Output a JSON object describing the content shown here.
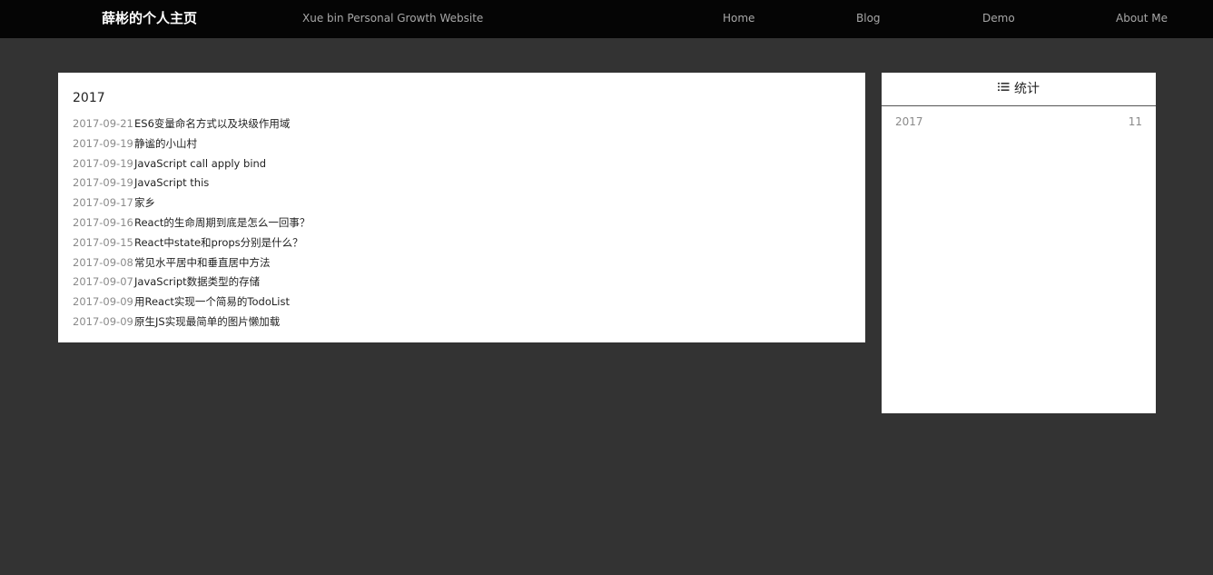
{
  "navbar": {
    "brand": "薛彬的个人主页",
    "tagline": "Xue bin Personal Growth Website",
    "links": [
      {
        "label": "Home"
      },
      {
        "label": "Blog"
      },
      {
        "label": "Demo"
      },
      {
        "label": "About Me"
      }
    ]
  },
  "archive": {
    "year": "2017",
    "posts": [
      {
        "date": "2017-09-21",
        "title": "ES6变量命名方式以及块级作用域"
      },
      {
        "date": "2017-09-19",
        "title": "静谧的小山村"
      },
      {
        "date": "2017-09-19",
        "title": "JavaScript call apply bind"
      },
      {
        "date": "2017-09-19",
        "title": "JavaScript this"
      },
      {
        "date": "2017-09-17",
        "title": "家乡"
      },
      {
        "date": "2017-09-16",
        "title": "React的生命周期到底是怎么一回事？"
      },
      {
        "date": "2017-09-15",
        "title": "React中state和props分别是什么？"
      },
      {
        "date": "2017-09-08",
        "title": "常见水平居中和垂直居中方法"
      },
      {
        "date": "2017-09-07",
        "title": "JavaScript数据类型的存储"
      },
      {
        "date": "2017-09-09",
        "title": "用React实现一个简易的TodoList"
      },
      {
        "date": "2017-09-09",
        "title": "原生JS实现最简单的图片懒加载"
      }
    ]
  },
  "stats": {
    "icon": "list-icon",
    "title": "统计",
    "rows": [
      {
        "year": "2017",
        "count": "11"
      }
    ]
  },
  "colors": {
    "navbar_bg": "#050505",
    "page_bg": "#333333",
    "panel_bg": "#ffffff",
    "nav_text": "#a8a8a8",
    "date_text": "#8a8a8a",
    "title_text": "#222222"
  }
}
